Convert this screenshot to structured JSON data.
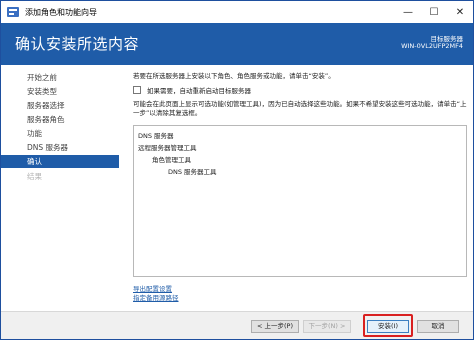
{
  "window": {
    "title": "添加角色和功能向导",
    "minimize_glyph": "—",
    "maximize_glyph": "☐",
    "close_glyph": "✕"
  },
  "header": {
    "title": "确认安装所选内容",
    "target_server_label": "目标服务器",
    "target_server_name": "WIN-0VL2UFP2MF4"
  },
  "nav": {
    "items": [
      {
        "label": "开始之前",
        "state": "normal"
      },
      {
        "label": "安装类型",
        "state": "normal"
      },
      {
        "label": "服务器选择",
        "state": "normal"
      },
      {
        "label": "服务器角色",
        "state": "normal"
      },
      {
        "label": "功能",
        "state": "normal"
      },
      {
        "label": "DNS 服务器",
        "state": "normal"
      },
      {
        "label": "确认",
        "state": "active"
      },
      {
        "label": "结果",
        "state": "disabled"
      }
    ]
  },
  "content": {
    "intro": "若要在所选服务器上安装以下角色、角色服务或功能，请单击“安装”。",
    "restart_checkbox_label": "如果需要，自动重新启动目标服务器",
    "restart_checked": false,
    "description": "可能会在此页面上显示可选功能(如管理工具)，因为已自动选择这些功能。如果不希望安装这些可选功能，请单击“上一步”以清除其复选框。",
    "features": [
      {
        "label": "DNS 服务器",
        "indent": 0
      },
      {
        "label": "远程服务器管理工具",
        "indent": 0
      },
      {
        "label": "角色管理工具",
        "indent": 1
      },
      {
        "label": "DNS 服务器工具",
        "indent": 2
      }
    ],
    "export_link": "导出配置设置",
    "alt_source_link": "指定备用源路径"
  },
  "buttons": {
    "previous": "< 上一步(P)",
    "next": "下一步(N) >",
    "install": "安装(I)",
    "cancel": "取消"
  },
  "colors": {
    "accent": "#1f5ca8",
    "highlight": "#d92020"
  }
}
